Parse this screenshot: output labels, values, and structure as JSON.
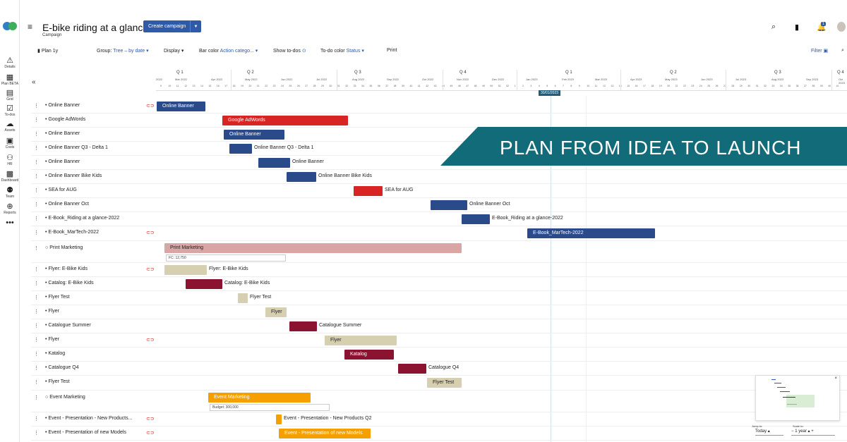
{
  "app": {
    "rail": [
      {
        "icon": "warning-icon",
        "glyph": "⚠",
        "label": "Details"
      },
      {
        "icon": "calendar-icon",
        "glyph": "▦",
        "label": "Plan BETA"
      },
      {
        "icon": "grid-icon",
        "glyph": "▤",
        "label": "Grid"
      },
      {
        "icon": "todo-icon",
        "glyph": "☑",
        "label": "To-dos"
      },
      {
        "icon": "cloud-icon",
        "glyph": "☁",
        "label": "Assets"
      },
      {
        "icon": "costs-icon",
        "glyph": "▣",
        "label": "Costs"
      },
      {
        "icon": "hr-icon",
        "glyph": "⚇",
        "label": "HR"
      },
      {
        "icon": "dashboard-icon",
        "glyph": "▩",
        "label": "Dashboard"
      },
      {
        "icon": "team-icon",
        "glyph": "⚉",
        "label": "Team"
      },
      {
        "icon": "reports-icon",
        "glyph": "⊕",
        "label": "Reports"
      },
      {
        "icon": "more-icon",
        "glyph": "•••",
        "label": ""
      }
    ]
  },
  "header": {
    "title": "E-bike riding at a glance",
    "subtitle": "Campaign",
    "create_label": "Create campaign",
    "notification_count": "1"
  },
  "toolbar": {
    "plan": "Plan 1y",
    "group_label": "Group:",
    "group_value": "Tree – by date",
    "display": "Display",
    "bar_color_label": "Bar color",
    "bar_color_value": "Action catego...",
    "show_todos": "Show to-dos",
    "todo_color_label": "To-do color",
    "todo_color_value": "Status",
    "print": "Print",
    "filter": "Filter"
  },
  "timeline": {
    "quarters": [
      "Q 1",
      "Q 2",
      "Q 3",
      "Q 4",
      "Q 1",
      "Q 2",
      "Q 3",
      "Q 4"
    ],
    "months": [
      "2022",
      "Mar 2022",
      "Apr 2022",
      "May 2022",
      "Jun 2022",
      "Jul 2022",
      "Aug 2022",
      "Sep 2022",
      "Oct 2022",
      "Nov 2022",
      "Dec 2022",
      "Jan 2023",
      "Feb 2023",
      "Mar 2023",
      "Apr 2023",
      "May 2023",
      "Jun 2023",
      "Jul 2023",
      "Aug 2023",
      "Sep 2023",
      "Oct 2023"
    ],
    "today": "30/01/2023"
  },
  "banner": "PLAN FROM IDEA TO LAUNCH",
  "rows": [
    {
      "name": "Online Banner",
      "link": true,
      "bar": "Online Banner",
      "color": "#2b4a8a",
      "inside": true
    },
    {
      "name": "Google AdWords",
      "link": false,
      "bar": "Google AdWords",
      "color": "#d92424",
      "inside": true
    },
    {
      "name": "Online Banner",
      "link": false,
      "bar": "Online Banner",
      "color": "#2b4a8a",
      "inside": true
    },
    {
      "name": "Online Banner Q3 - Delta 1",
      "link": false,
      "bar": "Online Banner Q3 - Delta 1",
      "color": "#2b4a8a",
      "inside": false
    },
    {
      "name": "Online Banner",
      "link": false,
      "bar": "Online Banner",
      "color": "#2b4a8a",
      "inside": false
    },
    {
      "name": "Online Banner Bike Kids",
      "link": false,
      "bar": "Online Banner Bike Kids",
      "color": "#2b4a8a",
      "inside": false
    },
    {
      "name": "SEA for AUG",
      "link": false,
      "bar": "SEA for AUG",
      "color": "#d92424",
      "inside": false
    },
    {
      "name": "Online Banner Oct",
      "link": false,
      "bar": "Online Banner Oct",
      "color": "#2b4a8a",
      "inside": false
    },
    {
      "name": "E-Book_Riding at a glance-2022",
      "link": false,
      "bar": "E-Book_Riding at a glance-2022",
      "color": "#2b4a8a",
      "inside": false
    },
    {
      "name": "E-Book_MarTech-2022",
      "link": true,
      "bar": "E-Book_MarTech-2022",
      "color": "#2b4a8a",
      "inside": true
    },
    {
      "name": "Print Marketing",
      "link": false,
      "bar": "Print Marketing",
      "color": "#d9a5a5",
      "inside": true,
      "group": true,
      "note": "FC: 12,750"
    },
    {
      "name": "Flyer: E-Bike Kids",
      "link": true,
      "bar": "Flyer: E-Bike Kids",
      "color": "#d6cfb0",
      "inside": false
    },
    {
      "name": "Catalog: E-Bike Kids",
      "link": false,
      "bar": "Catalog: E-Bike Kids",
      "color": "#8b1230",
      "inside": false
    },
    {
      "name": "Flyer Test",
      "link": false,
      "bar": "Flyer Test",
      "color": "#d6cfb0",
      "inside": false
    },
    {
      "name": "Flyer",
      "link": false,
      "bar": "Flyer",
      "color": "#d6cfb0",
      "inside": true
    },
    {
      "name": "Catalogue Summer",
      "link": false,
      "bar": "Catalogue Summer",
      "color": "#8b1230",
      "inside": false
    },
    {
      "name": "Flyer",
      "link": true,
      "bar": "Flyer",
      "color": "#d6cfb0",
      "inside": true
    },
    {
      "name": "Katalog",
      "link": false,
      "bar": "Katalog",
      "color": "#8b1230",
      "inside": true
    },
    {
      "name": "Catalogue Q4",
      "link": false,
      "bar": "Catalogue Q4",
      "color": "#8b1230",
      "inside": false
    },
    {
      "name": "Flyer Test",
      "link": false,
      "bar": "Flyer Test",
      "color": "#d6cfb0",
      "inside": true
    },
    {
      "name": "Event Marketing",
      "link": false,
      "bar": "Event Marketing",
      "color": "#f5a000",
      "inside": true,
      "group": true,
      "note": "Budget: 300,000"
    },
    {
      "name": "Event - Presentation - New Products...",
      "link": true,
      "bar": "Event - Presentation - New Products Q2",
      "color": "#f5a000",
      "inside": false
    },
    {
      "name": "Event - Presentation of new Models",
      "link": true,
      "bar": "Event - Presentation of new Models",
      "color": "#f5a000",
      "inside": true
    }
  ],
  "scale": {
    "jump_label": "Jump to:",
    "jump_value": "Today",
    "scale_label": "Scale to:",
    "scale_value": "1 year"
  }
}
